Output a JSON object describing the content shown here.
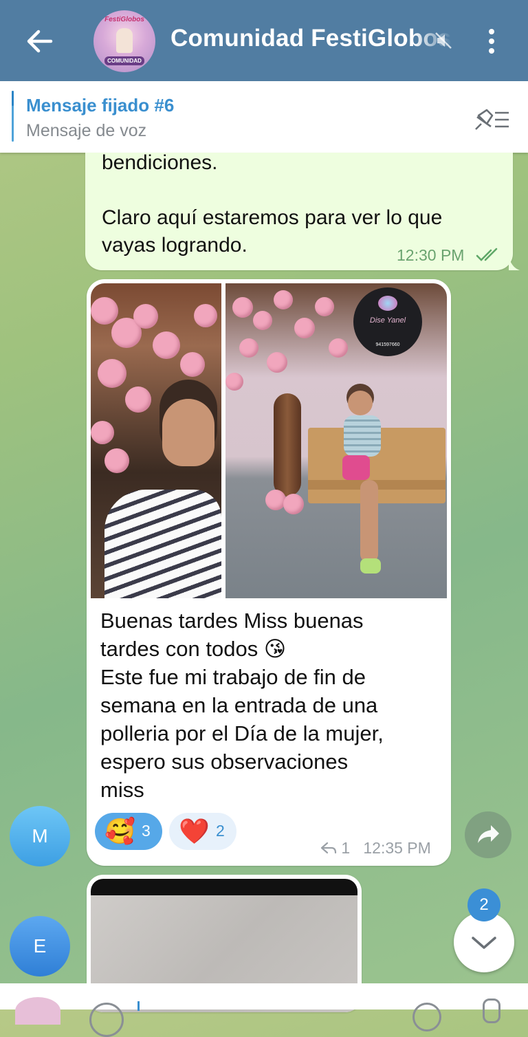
{
  "header": {
    "title": "Comunidad FestiGlobos",
    "avatar_text_top": "FestiGlobos",
    "avatar_text_bottom": "COMUNIDAD",
    "bg_color": "#517da2"
  },
  "pinned": {
    "title": "Mensaje fijado #6",
    "subtitle": "Mensaje de voz"
  },
  "messages": {
    "outgoing": {
      "line1": "bendiciones.",
      "line2": "Claro aquí estaremos para ver lo que",
      "line3": "vayas logrando.",
      "time": "12:30 PM",
      "status_icon": "double-check-icon"
    },
    "incoming": {
      "photo_logo_name": "Dise Yanel",
      "photo_logo_phone": "941597660",
      "caption_lines": [
        "Buenas tardes Miss buenas",
        "tardes con todos 😘",
        "Este fue mi trabajo de fin de",
        "semana en la entrada de una",
        "polleria por el Día de la mujer,",
        "espero sus observaciones",
        "miss"
      ],
      "reactions": [
        {
          "emoji": "🥰",
          "count": "3"
        },
        {
          "emoji": "❤️",
          "count": "2"
        }
      ],
      "reply_count": "1",
      "time": "12:35 PM"
    }
  },
  "avatars": {
    "m_letter": "M",
    "e_letter": "E"
  },
  "unread_count": "2"
}
